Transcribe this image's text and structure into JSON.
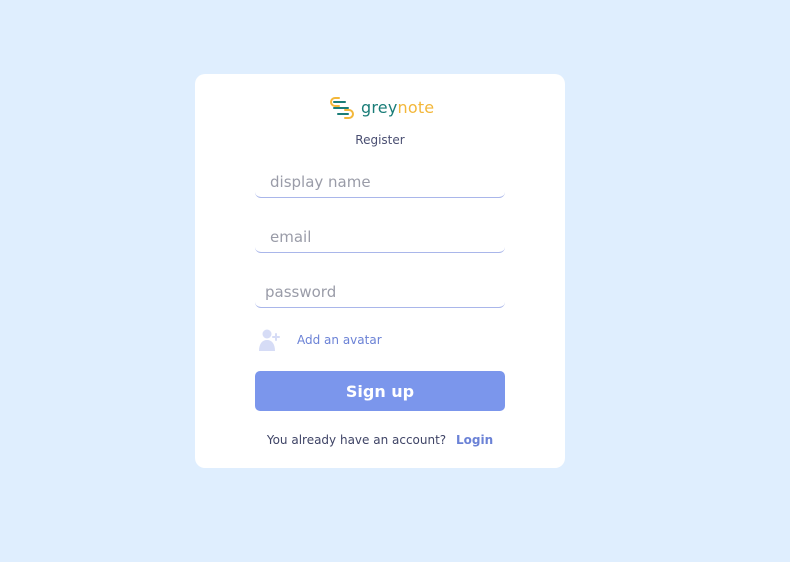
{
  "brand": {
    "icon": "layers-logo-icon",
    "name_part1": "grey",
    "name_part2": "note",
    "colors": {
      "grey": "#1a7d78",
      "note": "#f3b73a"
    }
  },
  "form": {
    "title": "Register",
    "display_name": {
      "placeholder": "display name",
      "value": ""
    },
    "email": {
      "placeholder": "email",
      "value": ""
    },
    "password": {
      "placeholder": "password",
      "value": ""
    },
    "avatar": {
      "icon": "add-user-icon",
      "label": "Add an avatar"
    },
    "submit_label": "Sign up",
    "footer_text": "You already have an account?",
    "login_label": "Login"
  },
  "colors": {
    "background": "#dfeefe",
    "card": "#ffffff",
    "accent": "#7b96ec",
    "link": "#6b82d6"
  }
}
